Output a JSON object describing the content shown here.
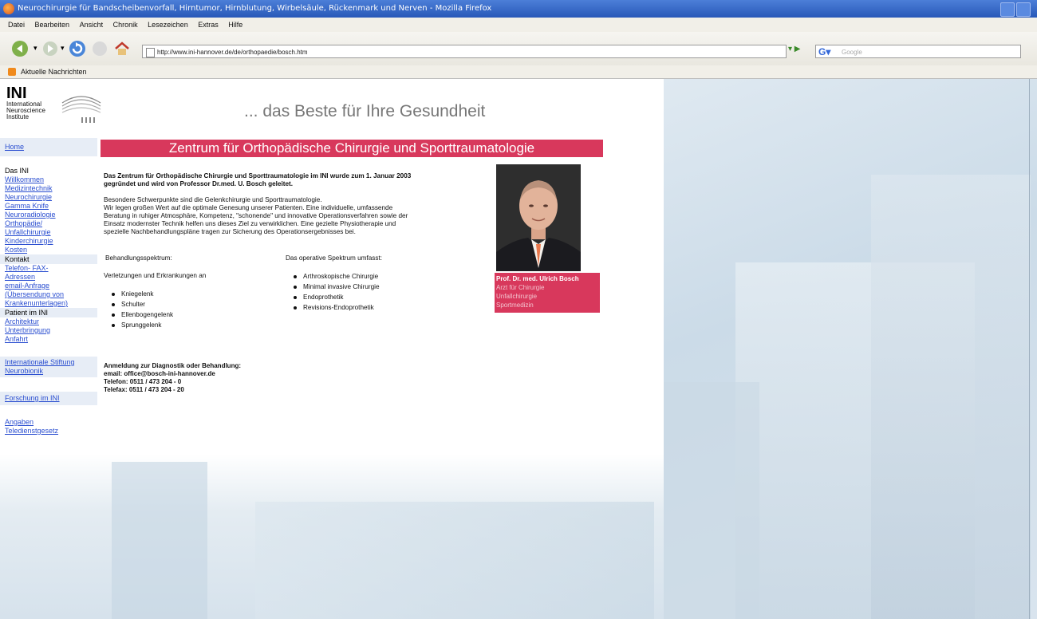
{
  "window": {
    "title": "Neurochirurgie für Bandscheibenvorfall, Hirntumor, Hirnblutung, Wirbelsäule, Rückenmark und Nerven - Mozilla Firefox"
  },
  "menu": [
    "Datei",
    "Bearbeiten",
    "Ansicht",
    "Chronik",
    "Lesezeichen",
    "Extras",
    "Hilfe"
  ],
  "toolbar": {
    "url": "http://www.ini-hannover.de/de/orthopaedie/bosch.htm",
    "search_placeholder": "Google"
  },
  "bookmarks": {
    "item": "Aktuelle Nachrichten"
  },
  "logo": {
    "name": "INI",
    "line1": "International",
    "line2": "Neuroscience",
    "line3": "Institute"
  },
  "slogan": "... das Beste für Ihre Gesundheit",
  "sidebar": {
    "home": "Home",
    "group1": "Das INI",
    "group1_items": [
      "Willkommen",
      "Medizintechnik",
      "Neurochirurgie",
      "Gamma Knife",
      "Neuroradiologie",
      "Orthopädie/",
      "Unfallchirurgie",
      "Kinderchirurgie",
      "Kosten"
    ],
    "group2": "Kontakt",
    "group2_items": [
      "Telefon- FAX-",
      "Adressen",
      "email-Anfrage",
      "(Übersendung von",
      "Krankenunterlagen)"
    ],
    "group3": "Patient im INI",
    "group3_items": [
      "Architektur",
      "Unterbringung",
      "Anfahrt"
    ],
    "extra1": "Internationale Stiftung",
    "extra2": "Neurobionik",
    "research": "Forschung im INI",
    "legal1": "Angaben",
    "legal2": "Teledienstgesetz"
  },
  "main": {
    "heading": "Zentrum für Orthopädische Chirurgie und Sporttraumatologie",
    "intro1": "Das Zentrum für Orthopädische Chirurgie und Sporttraumatologie im INI wurde zum 1. Januar 2003",
    "intro2": "gegründet und wird von Professor Dr.med. U. Bosch geleitet.",
    "p1": "Besondere Schwerpunkte sind die Gelenkchirurgie und Sporttraumatologie.",
    "p2": "Wir legen großen Wert auf die optimale Genesung unserer Patienten. Eine individuelle, umfassende",
    "p3": "Beratung in ruhiger Atmosphäre, Kompetenz, \"schonende\" und innovative Operationsverfahren sowie der",
    "p4": "Einsatz modernster Technik helfen uns dieses Ziel zu verwirklichen. Eine gezielte Physiotherapie und",
    "p5": "spezielle Nachbehandlungspläne tragen zur Sicherung des Operationsergebnisses bei.",
    "col1_title": "Behandlungsspektrum:",
    "col1_sub": "Verletzungen und Erkrankungen an",
    "col1_items": [
      "Kniegelenk",
      "Schulter",
      "Ellenbogengelenk",
      "Sprunggelenk"
    ],
    "col2_title": "Das operative Spektrum umfasst:",
    "col2_items": [
      "Arthroskopische Chirurgie",
      "Minimal invasive Chirurgie",
      "Endoprothetik",
      "Revisions-Endoprothetik"
    ],
    "contact1": "Anmeldung zur Diagnostik oder Behandlung:",
    "contact2": "email: office@bosch-ini-hannover.de",
    "contact3": "Telefon: 0511 / 473 204 - 0",
    "contact4": "Telefax: 0511 / 473 204 - 20"
  },
  "caption": {
    "name": "Prof. Dr. med. Ulrich Bosch",
    "l1": "Arzt für Chirurgie",
    "l2": "Unfallchirurgie",
    "l3": "Sportmedizin"
  }
}
